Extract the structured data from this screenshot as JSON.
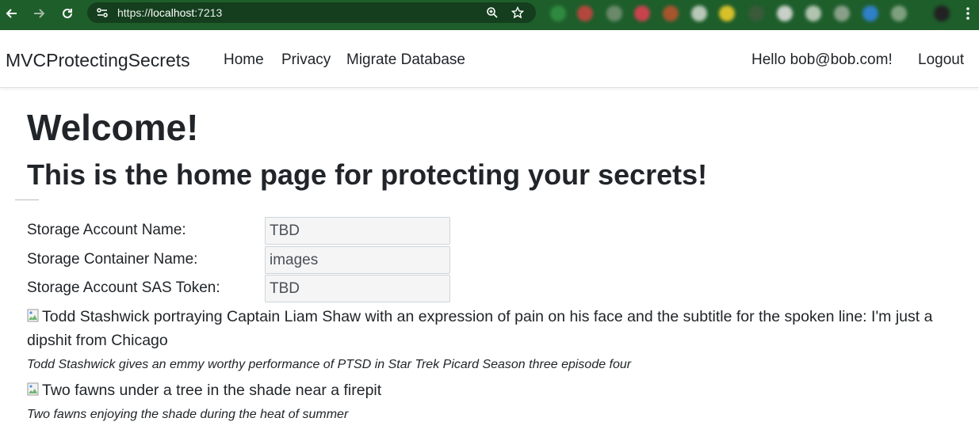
{
  "browser": {
    "url_scheme": "https://",
    "url_host": "localhost",
    "url_port": ":7213"
  },
  "navbar": {
    "brand": "MVCProtectingSecrets",
    "links": [
      "Home",
      "Privacy",
      "Migrate Database"
    ],
    "greeting": "Hello bob@bob.com!",
    "logout": "Logout"
  },
  "main": {
    "title": "Welcome!",
    "subtitle": "This is the home page for protecting your secrets!",
    "fields": [
      {
        "label": "Storage Account Name:",
        "value": "TBD"
      },
      {
        "label": "Storage Container Name:",
        "value": "images"
      },
      {
        "label": "Storage Account SAS Token:",
        "value": "TBD"
      }
    ],
    "images": [
      {
        "alt": "Todd Stashwick portraying Captain Liam Shaw with an expression of pain on his face and the subtitle for the spoken line: I'm just a dipshit from Chicago",
        "caption": "Todd Stashwick gives an emmy worthy performance of PTSD in Star Trek Picard Season three episode four"
      },
      {
        "alt": "Two fawns under a tree in the shade near a firepit",
        "caption": "Two fawns enjoying the shade during the heat of summer"
      }
    ]
  }
}
